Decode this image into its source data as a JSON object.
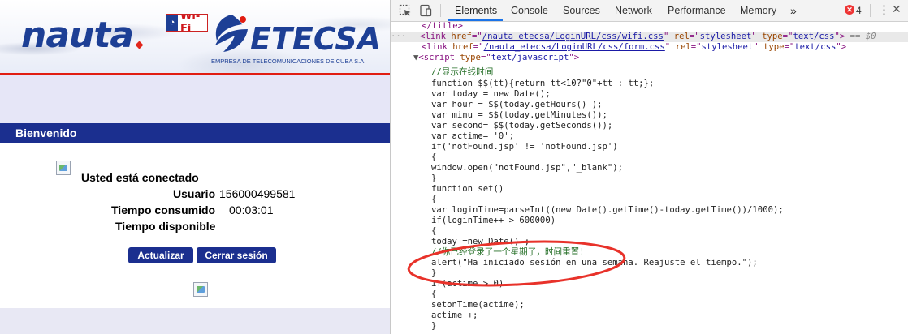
{
  "portal": {
    "logo_nauta": "nauta",
    "logo_wifi_badge": "Wi-Fi",
    "logo_etecsa": "ETECSA",
    "logo_etecsa_sub": "EMPRESA DE TELECOMUNICACIONES DE CUBA S.A.",
    "welcome_title": "Bienvenido",
    "status_label": "Usted está conectado",
    "user_label": "Usuario",
    "user_value": "156000499581",
    "time_used_label": "Tiempo consumido",
    "time_used_value": "00:03:01",
    "time_available_label": "Tiempo disponible",
    "btn_refresh": "Actualizar",
    "btn_logout": "Cerrar sesión",
    "colors": {
      "brand_blue": "#1b2f8f",
      "brand_red": "#e11d12",
      "lavender": "#e6e6f7"
    }
  },
  "devtools": {
    "tabs": [
      "Elements",
      "Console",
      "Sources",
      "Network",
      "Performance",
      "Memory"
    ],
    "active_tab": "Elements",
    "more_tabs": "»",
    "error_count": "4",
    "icons": [
      "inspect-icon",
      "device-toolbar-icon",
      "error-icon",
      "kebab-menu-icon",
      "close-icon"
    ],
    "code": {
      "l1": "</title>",
      "l2_href": "/nauta_etecsa/LoginURL/css/wifi.css",
      "l2_rel": "stylesheet",
      "l2_type": "text/css",
      "l2_suffix": "== $0",
      "l3_href": "/nauta_etecsa/LoginURL/css/form.css",
      "l3_rel": "stylesheet",
      "l3_type": "text/css",
      "l4_type": "text/javascript",
      "l5": "//显示在线时间",
      "l6": "function $$(tt){return tt<10?\"0\"+tt : tt;};",
      "l7": "var today = new Date();",
      "l8": "var hour = $$(today.getHours() );",
      "l9": "var minu = $$(today.getMinutes());",
      "l10": "var second= $$(today.getSeconds());",
      "l11": "var actime= '0';",
      "l12": "if('notFound.jsp' != 'notFound.jsp')",
      "l13": "{",
      "l14": "window.open(\"notFound.jsp\",\"_blank\");",
      "l15": "}",
      "l16": "function set()",
      "l17": "{",
      "l18": "var loginTime=parseInt((new Date().getTime()-today.getTime())/1000);",
      "l19": "if(loginTime++ > 600000)",
      "l20": "{",
      "l21": "today =new Date() ;",
      "l22": "//你已经登录了一个星期了，时间重置!",
      "l23": "alert(\"Ha iniciado sesión en una semana. Reajuste el tiempo.\");",
      "l24": "}",
      "l25": "if(actime > 0)",
      "l26": "{",
      "l27": "setonTime(actime);",
      "l28": "actime++;",
      "l29": "}"
    },
    "annotation_color": "#e8322a"
  }
}
